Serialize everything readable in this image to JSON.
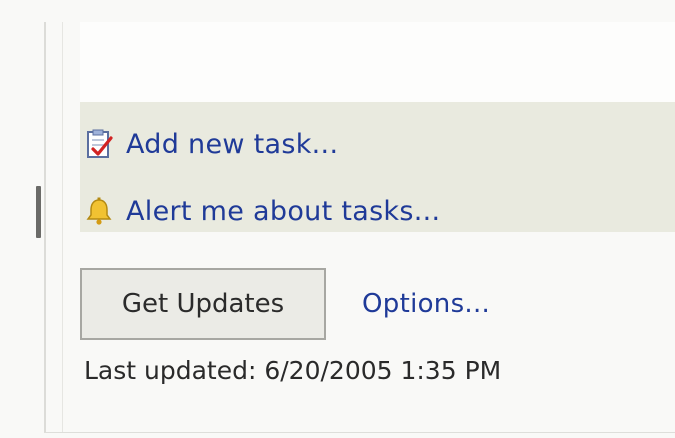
{
  "tasks_panel": {
    "actions": [
      {
        "label": "Add new task...",
        "icon": "add-task-icon"
      },
      {
        "label": "Alert me about tasks...",
        "icon": "bell-icon"
      }
    ]
  },
  "updates": {
    "get_updates_label": "Get Updates",
    "options_label": "Options...",
    "last_updated_text": "Last updated: 6/20/2005 1:35 PM"
  },
  "colors": {
    "link": "#1f3a98",
    "panel_background": "#e9eadf",
    "button_background": "#ebebe6"
  }
}
